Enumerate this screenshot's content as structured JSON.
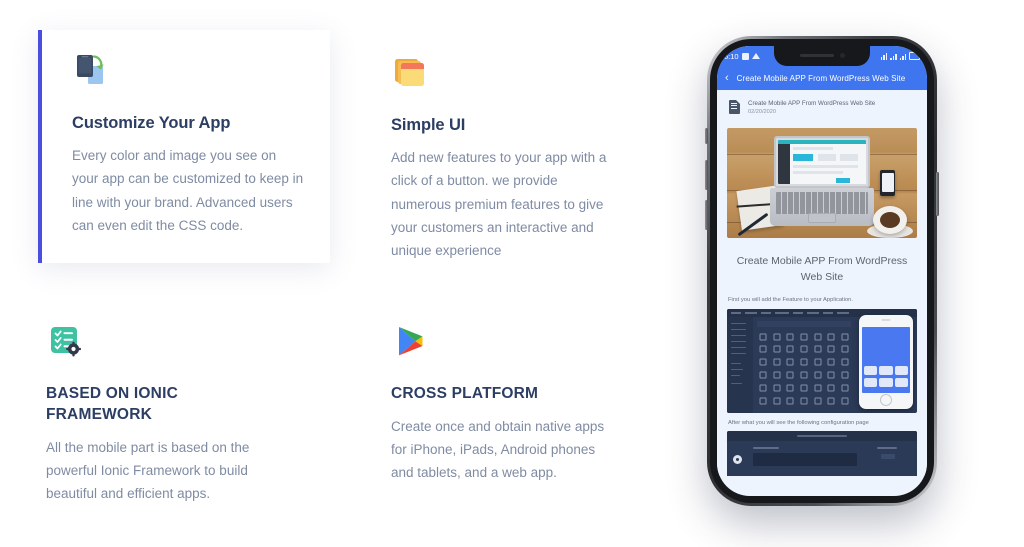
{
  "features": [
    {
      "id": "customize-your-app",
      "icon": "device-refresh-icon",
      "title": "Customize Your App",
      "body": "Every color and image you see on your app can be customized to keep in line with your brand. Advanced users can even edit the CSS code.",
      "highlighted": true,
      "accent": "#4a4de0"
    },
    {
      "id": "simple-ui",
      "icon": "stacked-notes-icon",
      "title": "Simple UI",
      "body": "Add new features to your app with a click of a button. we provide numerous premium features to give your customers an interactive and unique experience",
      "highlighted": false,
      "accent": "#f6c95a"
    },
    {
      "id": "based-on-ionic-framework",
      "icon": "checklist-gear-icon",
      "title": "BASED ON IONIC FRAMEWORK",
      "body": "All the mobile part is based on the powerful Ionic Framework to build beautiful and efficient apps.",
      "highlighted": false,
      "accent": "#3ec4a0"
    },
    {
      "id": "cross-platform",
      "icon": "google-play-icon",
      "title": "CROSS PLATFORM",
      "body": "Create once and obtain native apps for iPhone, iPads, Android phones and tablets, and a web app.",
      "highlighted": false,
      "accent": "#4285f4"
    }
  ],
  "phone": {
    "status_bar": {
      "time": "6:10",
      "icons": [
        "camera-icon",
        "download-icon",
        "wifi-icon",
        "signal-icon",
        "signal-icon",
        "battery-icon"
      ]
    },
    "app_bar": {
      "back_glyph": "‹",
      "title": "Create Mobile APP From WordPress Web Site",
      "color": "#3f76f0"
    },
    "article": {
      "meta_title": "Create Mobile APP From WordPress Web Site",
      "meta_date": "02/20/2020",
      "hero_image_alt": "laptop notebook phone and coffee on wooden desk",
      "headline": "Create Mobile APP From WordPress Web Site",
      "paragraph_1": "First you will add the Feature to your Application.",
      "screenshot_2_alt": "dark dashboard icon picker with iPhone preview",
      "paragraph_2": "After what you will see the following configuration page",
      "screenshot_3_alt": "page settings configuration panel"
    }
  },
  "theme": {
    "heading_color": "#2c3e63",
    "body_color": "#7f8ba3",
    "card_bg": "#ffffff",
    "page_bg": "#ffffff",
    "accent_indigo": "#4a4de0",
    "phone_blue": "#3f76f0",
    "screen_bg": "#eef4fd"
  }
}
